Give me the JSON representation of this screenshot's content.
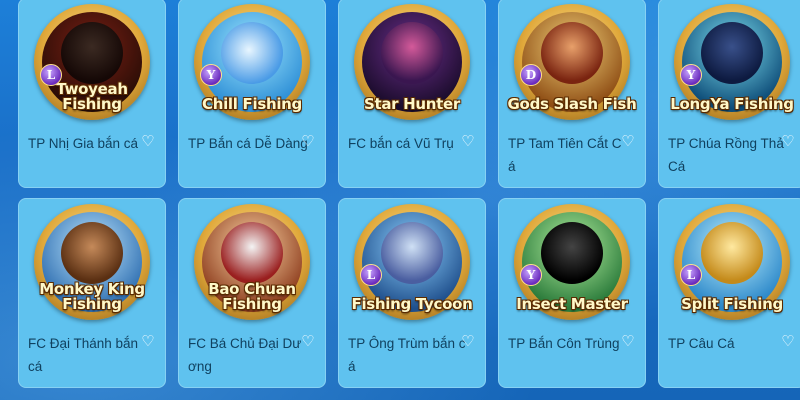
{
  "games": [
    {
      "logo": "Twoyeah Fishing",
      "badge": "L",
      "caption": "TP Nhị Gia bắn cá",
      "icon": "heart-outline-icon"
    },
    {
      "logo": "Chill Fishing",
      "badge": "Y",
      "caption": "TP Bắn cá Dễ Dàng",
      "icon": "heart-outline-icon"
    },
    {
      "logo": "Star Hunter",
      "badge": "",
      "caption": "FC bắn cá Vũ Trụ",
      "icon": "heart-outline-icon"
    },
    {
      "logo": "Gods Slash Fish",
      "badge": "D",
      "caption": "TP Tam Tiên Cắt Cá",
      "icon": "heart-outline-icon"
    },
    {
      "logo": "LongYa Fishing",
      "badge": "Y",
      "caption": "TP Chúa Rồng Thả Cá",
      "icon": "heart-outline-icon"
    },
    {
      "logo": "Monkey King Fishing",
      "badge": "",
      "caption": "FC Đại Thánh bắn cá",
      "icon": "heart-outline-icon"
    },
    {
      "logo": "Bao Chuan Fishing",
      "badge": "",
      "caption": "FC Bá Chủ Đại Dương",
      "icon": "heart-outline-icon"
    },
    {
      "logo": "Fishing Tycoon",
      "badge": "L",
      "caption": "TP Ông Trùm bắn cá",
      "icon": "heart-outline-icon"
    },
    {
      "logo": "Insect Master",
      "badge": "Y",
      "caption": "TP Bắn Côn Trùng",
      "icon": "heart-outline-icon"
    },
    {
      "logo": "Split Fishing",
      "badge": "L",
      "caption": "TP Câu Cá",
      "icon": "heart-outline-icon"
    }
  ],
  "heart_glyph": "♡"
}
